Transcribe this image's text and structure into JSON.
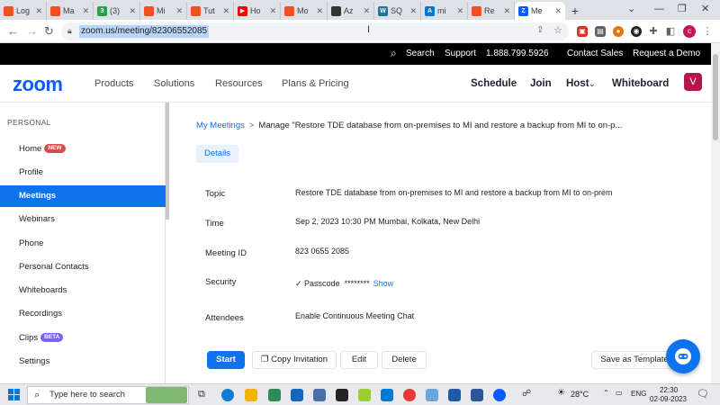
{
  "browser": {
    "tabs": [
      {
        "label": "Log",
        "color": "#f25022",
        "glyph": ""
      },
      {
        "label": "Ma",
        "color": "#f25022",
        "glyph": ""
      },
      {
        "label": "(3)",
        "color": "#25a24a",
        "glyph": "3"
      },
      {
        "label": "Mi",
        "color": "#f25022",
        "glyph": ""
      },
      {
        "label": "Tut",
        "color": "#f25022",
        "glyph": ""
      },
      {
        "label": "Ho",
        "color": "#ff0000",
        "glyph": "▶"
      },
      {
        "label": "Mo",
        "color": "#f25022",
        "glyph": ""
      },
      {
        "label": "Az",
        "color": "#333333",
        "glyph": ""
      },
      {
        "label": "SQ",
        "color": "#21759b",
        "glyph": "W"
      },
      {
        "label": "mi",
        "color": "#0078d4",
        "glyph": "A"
      },
      {
        "label": "Re",
        "color": "#f25022",
        "glyph": ""
      },
      {
        "label": "Me",
        "color": "#0b5cff",
        "glyph": "Z"
      }
    ],
    "new_tab": "+",
    "url": "zoom.us/meeting/82306552085",
    "profile_initial": "c"
  },
  "zoom_top": {
    "search": "Search",
    "support": "Support",
    "phone": "1.888.799.5926",
    "contact_sales": "Contact Sales",
    "request_demo": "Request a Demo"
  },
  "main_nav": {
    "logo": "zoom",
    "products": "Products",
    "solutions": "Solutions",
    "resources": "Resources",
    "plans": "Plans & Pricing",
    "schedule": "Schedule",
    "join": "Join",
    "host": "Host",
    "whiteboard": "Whiteboard",
    "avatar": "V"
  },
  "sidebar": {
    "heading": "PERSONAL",
    "items": [
      {
        "label": "Home",
        "badge": "NEW"
      },
      {
        "label": "Profile"
      },
      {
        "label": "Meetings",
        "active": true
      },
      {
        "label": "Webinars"
      },
      {
        "label": "Phone"
      },
      {
        "label": "Personal Contacts"
      },
      {
        "label": "Whiteboards"
      },
      {
        "label": "Recordings"
      },
      {
        "label": "Clips",
        "badge": "BETA"
      },
      {
        "label": "Settings"
      }
    ]
  },
  "content": {
    "breadcrumb_link": "My Meetings",
    "breadcrumb_sep": ">",
    "breadcrumb_current": "Manage \"Restore TDE database from on-premises to MI and restore a backup from MI to on-p...",
    "details_tab": "Details",
    "topic_label": "Topic",
    "topic_value": "Restore TDE database from on-premises to MI and restore a backup from MI to on-prem",
    "time_label": "Time",
    "time_value": "Sep 2, 2023 10:30 PM Mumbai, Kolkata, New Delhi",
    "meeting_id_label": "Meeting ID",
    "meeting_id_value": "823 0655 2085",
    "security_label": "Security",
    "security_value": "Passcode",
    "passcode_mask": "********",
    "show_link": "Show",
    "attendees_label": "Attendees",
    "attendees_value": "Enable Continuous Meeting Chat",
    "btn_start": "Start",
    "btn_copy": "Copy Invitation",
    "btn_edit": "Edit",
    "btn_delete": "Delete",
    "btn_template": "Save as Template"
  },
  "taskbar": {
    "search_placeholder": "Type here to search",
    "temperature": "28°C",
    "language": "ENG",
    "time": "22:30",
    "date": "02-09-2023"
  }
}
